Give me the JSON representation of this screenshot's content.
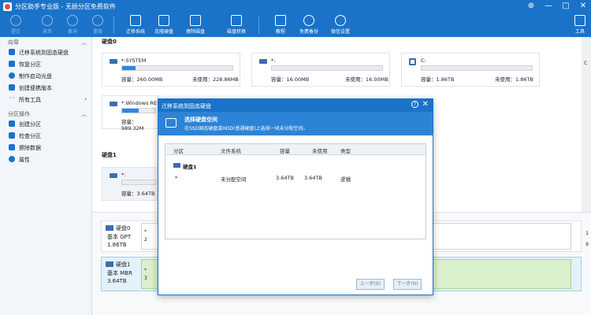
{
  "window": {
    "title": "分区助手专业版 - 无损分区免费软件",
    "controls": [
      "⊕",
      "—",
      "□",
      "✕"
    ]
  },
  "toolbar": {
    "buttons": [
      {
        "label": "提交",
        "icon": "check-icon"
      },
      {
        "label": "放弃",
        "icon": "cancel-icon"
      },
      {
        "label": "撤消",
        "icon": "undo-icon"
      },
      {
        "label": "重做",
        "icon": "redo-icon"
      },
      {
        "label": "迁移系统",
        "icon": "migrate-os-icon"
      },
      {
        "label": "克隆硬盘",
        "icon": "clone-disk-icon"
      },
      {
        "label": "擦除磁盘",
        "icon": "wipe-disk-icon"
      },
      {
        "label": "磁盘转换",
        "icon": "convert-disk-icon"
      },
      {
        "label": "教程",
        "icon": "tutorial-icon"
      },
      {
        "label": "免费备份",
        "icon": "backup-icon"
      },
      {
        "label": "微信设置",
        "icon": "wechat-icon"
      },
      {
        "label": "工具",
        "icon": "tools-icon"
      }
    ]
  },
  "sidebar": {
    "section1": "向导",
    "wizard_items": [
      "迁移系统到固态硬盘",
      "恢复分区",
      "制作启动光盘",
      "创建便携版本",
      "所有工具"
    ],
    "section2": "分区操作",
    "partition_items": [
      "创建分区",
      "检查分区",
      "擦除数据",
      "属性"
    ]
  },
  "main": {
    "disk0_label": "硬盘0",
    "disk1_label": "硬盘1",
    "cards": [
      {
        "name": "*:SYSTEM",
        "cap": "容量：260.00MB",
        "free": "未使用：228.86MB",
        "used": 0.12
      },
      {
        "name": "*:",
        "cap": "容量：16.00MB",
        "free": "未使用：16.00MB",
        "used": 0.0
      },
      {
        "name": "C:",
        "cap": "容量：1.86TB",
        "free": "未使用：1.86TB",
        "used": 0.0
      },
      {
        "name": "*:Windows RE to",
        "cap": "容量：989.32M",
        "free": "",
        "used": 0.5
      },
      {
        "name": "*:",
        "cap": "容量：3.64TB",
        "free": "",
        "used": 0.0
      }
    ],
    "disk_rows": [
      {
        "name": "硬盘0",
        "type": "基本 GPT",
        "size": "1.86TB",
        "seg_label": "*",
        "seg_sub": "2"
      },
      {
        "name": "硬盘1",
        "type": "基本 MBR",
        "size": "3.64TB",
        "seg_label": "*",
        "seg_sub": "3"
      }
    ],
    "scroll_labels": [
      "C",
      "1",
      "9"
    ]
  },
  "dialog": {
    "title": "迁移系统到固态硬盘",
    "help": "?",
    "close": "✕",
    "banner_title": "选择硬盘空间",
    "banner_sub": "在SSD固态硬盘或HDD(普通硬盘)上选择一块未分配空间。",
    "columns": [
      "分区",
      "文件系统",
      "容量",
      "未使用",
      "类型"
    ],
    "group": "硬盘1",
    "row": {
      "part": "*",
      "fs": "未分配空间",
      "cap": "3.64TB",
      "free": "3.64TB",
      "type": "逻辑"
    },
    "buttons": {
      "prev": "上一步(B)",
      "next": "下一步(N)"
    }
  }
}
